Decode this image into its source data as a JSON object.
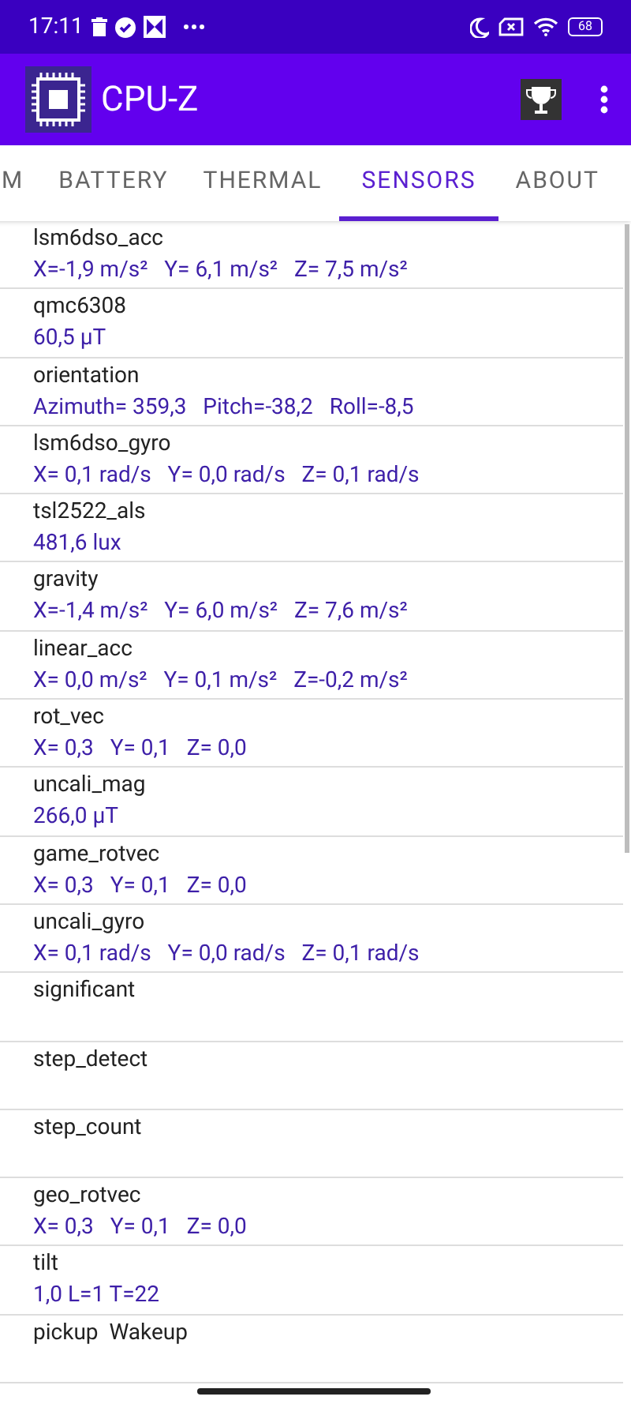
{
  "status_bar": {
    "time": "17:11",
    "battery": "68"
  },
  "app_bar": {
    "title": "CPU-Z"
  },
  "tabs": [
    {
      "label": "M",
      "selected": false
    },
    {
      "label": "BATTERY",
      "selected": false
    },
    {
      "label": "THERMAL",
      "selected": false
    },
    {
      "label": "SENSORS",
      "selected": true
    },
    {
      "label": "ABOUT",
      "selected": false
    }
  ],
  "sensors": [
    {
      "name": "lsm6dso_acc",
      "value": "X=-1,9 m/s²   Y= 6,1 m/s²   Z= 7,5 m/s²"
    },
    {
      "name": "qmc6308",
      "value": "60,5 μT"
    },
    {
      "name": "orientation",
      "value": "Azimuth= 359,3   Pitch=-38,2   Roll=-8,5"
    },
    {
      "name": "lsm6dso_gyro",
      "value": "X= 0,1 rad/s   Y= 0,0 rad/s   Z= 0,1 rad/s"
    },
    {
      "name": "tsl2522_als",
      "value": "481,6 lux"
    },
    {
      "name": "gravity",
      "value": "X=-1,4 m/s²   Y= 6,0 m/s²   Z= 7,6 m/s²"
    },
    {
      "name": "linear_acc",
      "value": "X= 0,0 m/s²   Y= 0,1 m/s²   Z=-0,2 m/s²"
    },
    {
      "name": "rot_vec",
      "value": "X= 0,3   Y= 0,1   Z= 0,0"
    },
    {
      "name": "uncali_mag",
      "value": "266,0 μT"
    },
    {
      "name": "game_rotvec",
      "value": "X= 0,3   Y= 0,1   Z= 0,0"
    },
    {
      "name": "uncali_gyro",
      "value": "X= 0,1 rad/s   Y= 0,0 rad/s   Z= 0,1 rad/s"
    },
    {
      "name": "significant"
    },
    {
      "name": "step_detect"
    },
    {
      "name": "step_count"
    },
    {
      "name": "geo_rotvec",
      "value": "X= 0,3   Y= 0,1   Z= 0,0"
    },
    {
      "name": "tilt",
      "value": "1,0 L=1 T=22"
    },
    {
      "name": "pickup  Wakeup"
    }
  ]
}
